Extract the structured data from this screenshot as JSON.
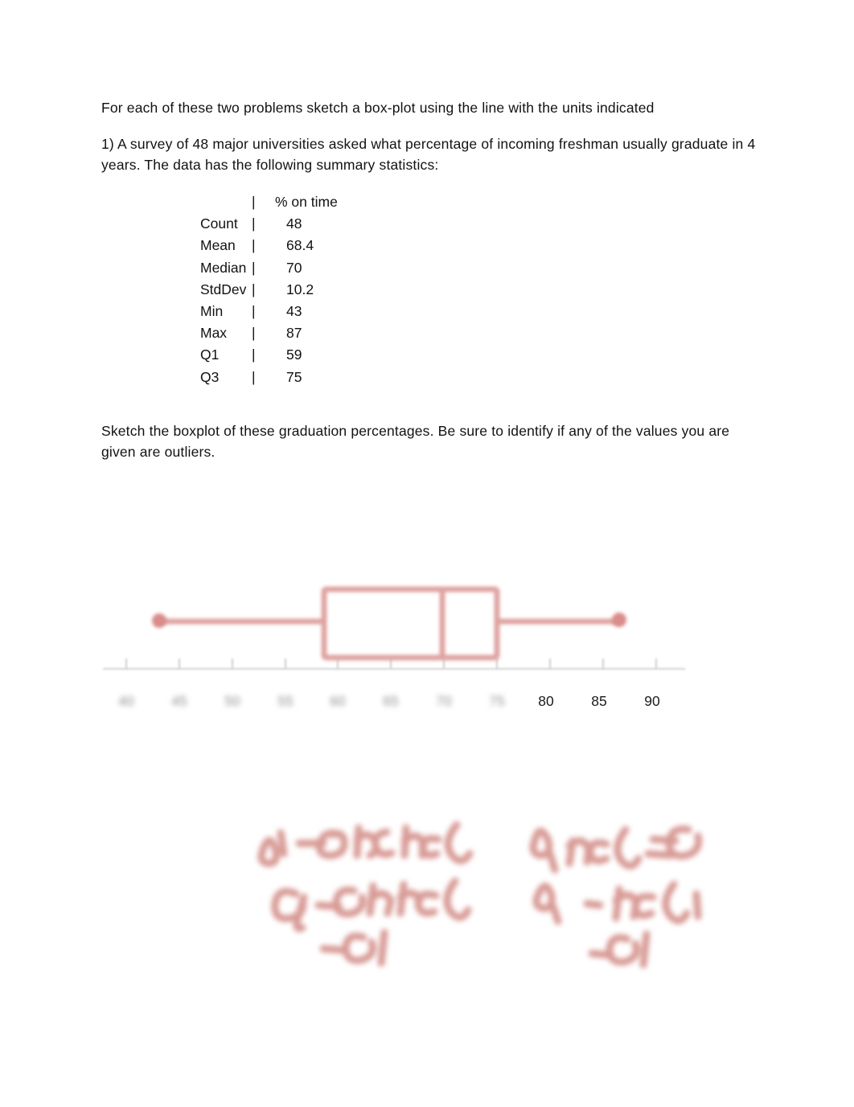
{
  "document": {
    "intro_line": "For each of these two problems sketch a box-plot using the line with the units indicated",
    "problem_1": "1)  A survey of 48 major universities asked what percentage of incoming freshman usually graduate in 4 years.  The data has the following summary statistics:",
    "sketch_instruction": "Sketch the boxplot of these graduation percentages.  Be sure to identify if any of the values you are given are outliers."
  },
  "stats_table": {
    "header": {
      "label": "",
      "pipe": "|",
      "value": "% on time"
    },
    "rows": [
      {
        "label": "Count",
        "pipe": "|",
        "value": "48"
      },
      {
        "label": "Mean",
        "pipe": "|",
        "value": "68.4"
      },
      {
        "label": "Median",
        "pipe": "|",
        "value": "70"
      },
      {
        "label": "StdDev",
        "pipe": "|",
        "value": "10.2"
      },
      {
        "label": "Min",
        "pipe": "|",
        "value": "43"
      },
      {
        "label": "Max",
        "pipe": "|",
        "value": "87"
      },
      {
        "label": "Q1",
        "pipe": "|",
        "value": "59"
      },
      {
        "label": "Q3",
        "pipe": "|",
        "value": "75"
      }
    ]
  },
  "chart_data": {
    "type": "box",
    "title": "",
    "xlabel": "",
    "ylabel": "",
    "orientation": "horizontal",
    "xlim": [
      38.2,
      92.5
    ],
    "grid": false,
    "legend": null,
    "ink_color": "#dfa3a0",
    "axis_color": "#d8d8d8",
    "axis_ticks": [
      40,
      45,
      50,
      55,
      60,
      65,
      70,
      75,
      80,
      85,
      90
    ],
    "axis_tick_labels": [
      {
        "value": 40,
        "text": "40",
        "legible": false
      },
      {
        "value": 45,
        "text": "45",
        "legible": false
      },
      {
        "value": 50,
        "text": "50",
        "legible": false
      },
      {
        "value": 55,
        "text": "55",
        "legible": false
      },
      {
        "value": 60,
        "text": "60",
        "legible": false
      },
      {
        "value": 65,
        "text": "65",
        "legible": false
      },
      {
        "value": 70,
        "text": "70",
        "legible": false
      },
      {
        "value": 75,
        "text": "75",
        "legible": false
      },
      {
        "value": 80,
        "text": "80",
        "legible": true
      },
      {
        "value": 85,
        "text": "85",
        "legible": true
      },
      {
        "value": 90,
        "text": "90",
        "legible": true
      }
    ],
    "box": {
      "lower_whisker": 40,
      "q1": 59,
      "median": 70,
      "q3": 75,
      "upper_whisker": 87,
      "whisker_end_markers": [
        "dot",
        "dot"
      ]
    }
  },
  "annotations": {
    "note_left": {
      "legible": false,
      "lines": [
        "",
        "",
        ""
      ]
    },
    "note_right": {
      "legible": false,
      "lines": [
        "",
        "",
        ""
      ]
    }
  }
}
